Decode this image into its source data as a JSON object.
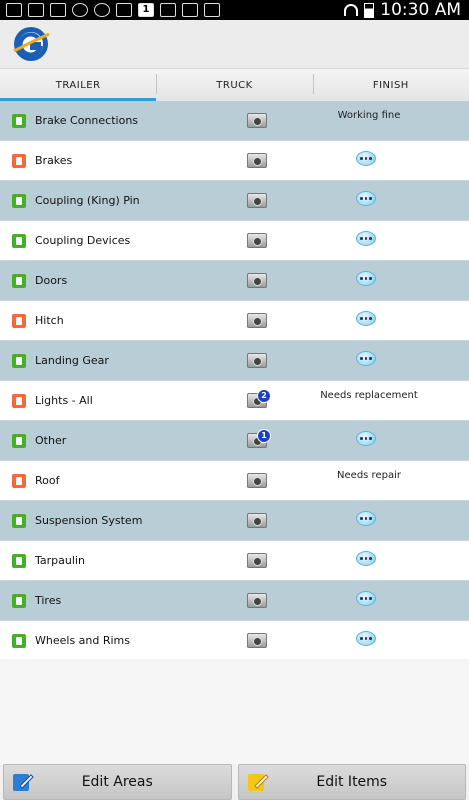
{
  "statusbar": {
    "time": "10:30 AM",
    "left_icons": [
      "image-icon",
      "message-icon",
      "mail-icon",
      "app-icon",
      "owl-icon",
      "bag-icon",
      "calendar-icon",
      "usb-icon",
      "dropbox-icon",
      "clipboard-icon"
    ],
    "calendar_day": "1"
  },
  "tabs": [
    {
      "label": "TRAILER",
      "active": true
    },
    {
      "label": "TRUCK",
      "active": false
    },
    {
      "label": "FINISH",
      "active": false
    }
  ],
  "items": [
    {
      "label": "Brake Connections",
      "status": "ok",
      "note": "Working fine",
      "photo_count": ""
    },
    {
      "label": "Brakes",
      "status": "bad",
      "note": "",
      "photo_count": ""
    },
    {
      "label": "Coupling (King) Pin",
      "status": "ok",
      "note": "",
      "photo_count": ""
    },
    {
      "label": "Coupling Devices",
      "status": "ok",
      "note": "",
      "photo_count": ""
    },
    {
      "label": "Doors",
      "status": "ok",
      "note": "",
      "photo_count": ""
    },
    {
      "label": "Hitch",
      "status": "bad",
      "note": "",
      "photo_count": ""
    },
    {
      "label": "Landing Gear",
      "status": "ok",
      "note": "",
      "photo_count": ""
    },
    {
      "label": "Lights - All",
      "status": "bad",
      "note": "Needs replacement",
      "photo_count": "2"
    },
    {
      "label": "Other",
      "status": "ok",
      "note": "",
      "photo_count": "1"
    },
    {
      "label": "Roof",
      "status": "bad",
      "note": "Needs repair",
      "photo_count": ""
    },
    {
      "label": "Suspension System",
      "status": "ok",
      "note": "",
      "photo_count": ""
    },
    {
      "label": "Tarpaulin",
      "status": "ok",
      "note": "",
      "photo_count": ""
    },
    {
      "label": "Tires",
      "status": "ok",
      "note": "",
      "photo_count": ""
    },
    {
      "label": "Wheels and Rims",
      "status": "ok",
      "note": "",
      "photo_count": ""
    }
  ],
  "footer": {
    "edit_areas_label": "Edit Areas",
    "edit_items_label": "Edit Items"
  },
  "colors": {
    "accent": "#2b9fd9",
    "row_shaded": "#b9cdd7",
    "ok": "#43b02a",
    "bad": "#f06a3b"
  }
}
